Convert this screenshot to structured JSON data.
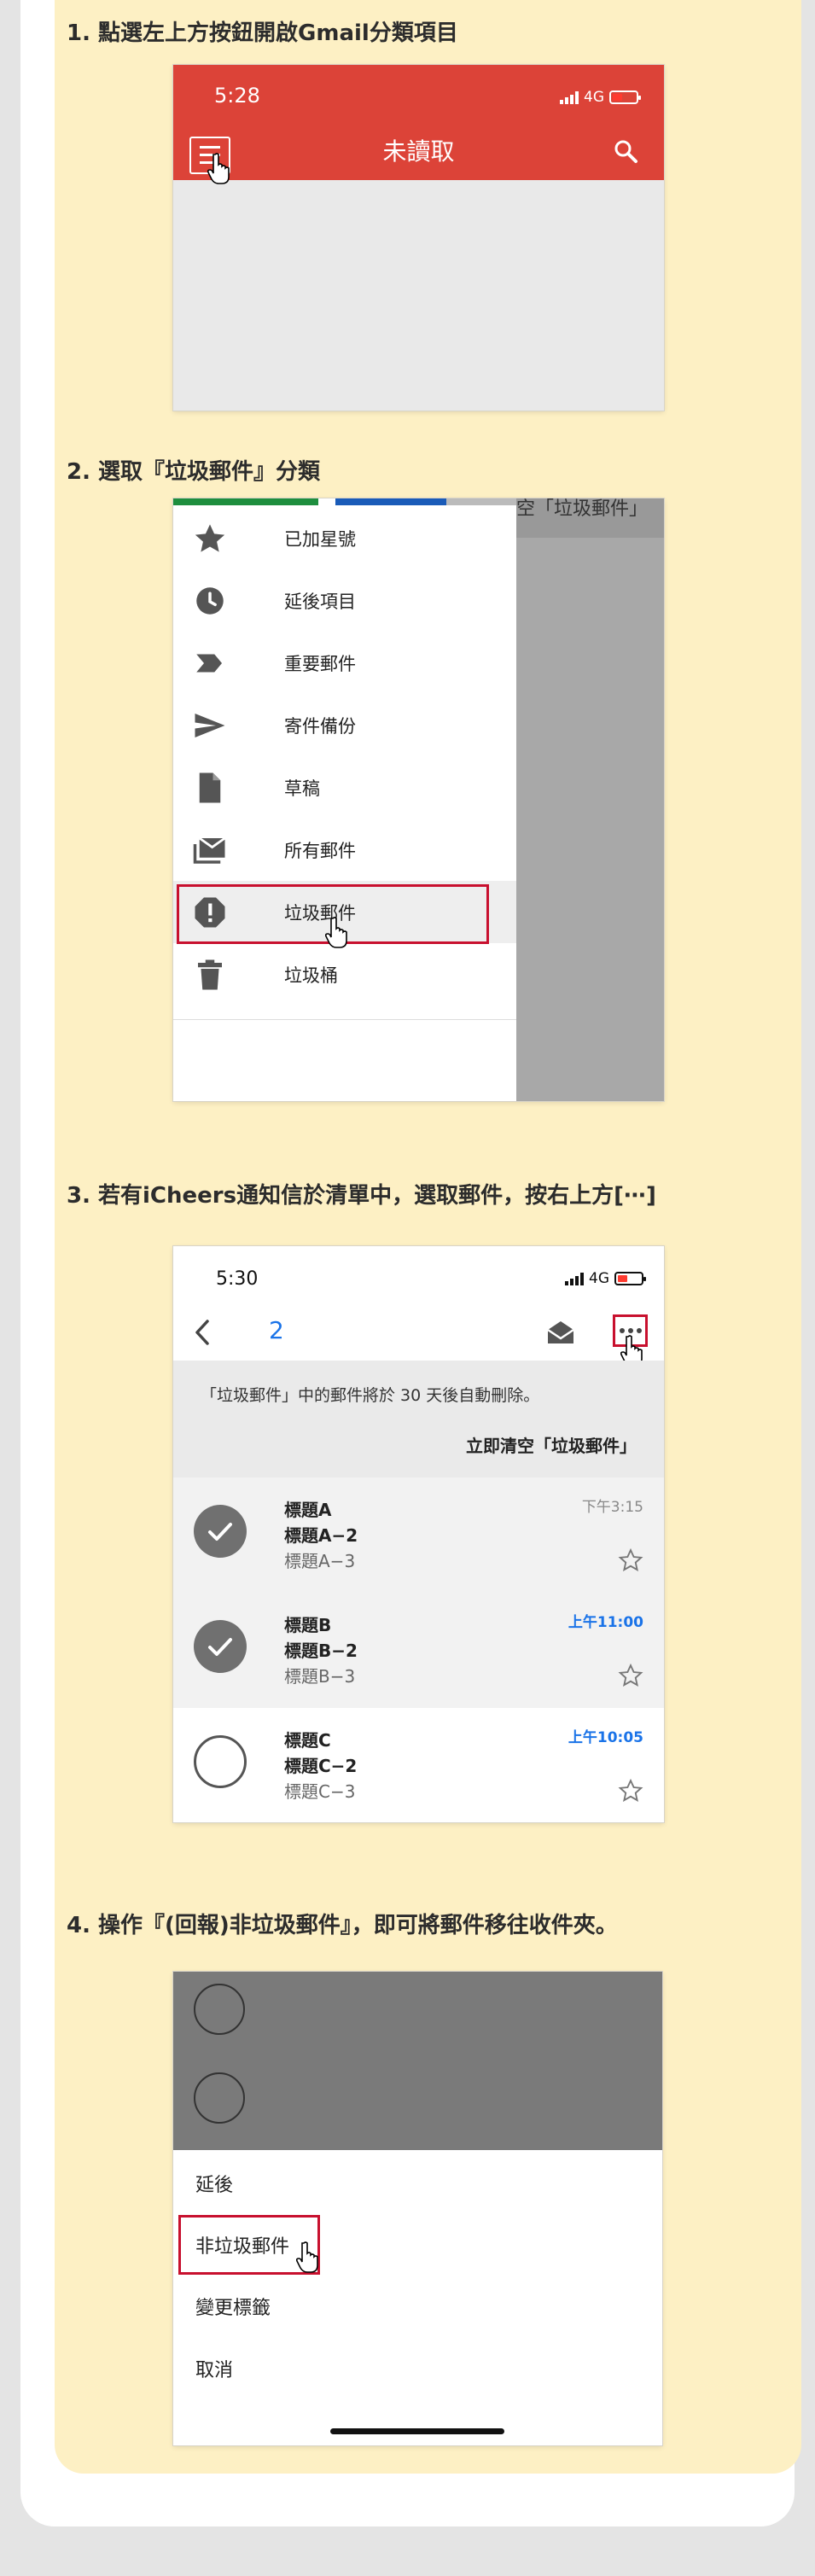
{
  "steps": [
    {
      "title": "1. 點選左上方按鈕開啟Gmail分類項目"
    },
    {
      "title": "2. 選取『垃圾郵件』分類"
    },
    {
      "title": "3. 若有iCheers通知信於清單中，選取郵件，按右上方[⋯]"
    },
    {
      "title": "4. 操作『(回報)非垃圾郵件』，即可將郵件移往收件夾。"
    }
  ],
  "screen1": {
    "time": "5:28",
    "network": "4G",
    "title": "未讀取",
    "accent": "#dc4338"
  },
  "screen2": {
    "overlay_text": "空「垃圾郵件」",
    "items": [
      {
        "label": "已加星號",
        "icon": "star-icon"
      },
      {
        "label": "延後項目",
        "icon": "clock-icon"
      },
      {
        "label": "重要郵件",
        "icon": "important-icon"
      },
      {
        "label": "寄件備份",
        "icon": "send-icon"
      },
      {
        "label": "草稿",
        "icon": "draft-icon"
      },
      {
        "label": "所有郵件",
        "icon": "all-mail-icon"
      },
      {
        "label": "垃圾郵件",
        "icon": "spam-icon",
        "selected": true
      },
      {
        "label": "垃圾桶",
        "icon": "trash-icon"
      }
    ]
  },
  "screen3": {
    "time": "5:30",
    "network": "4G",
    "selected_count": "2",
    "notice": "「垃圾郵件」中的郵件將於 30 天後自動刪除。",
    "empty_action": "立即清空「垃圾郵件」",
    "mails": [
      {
        "line1": "標題A",
        "line2": "標題A−2",
        "line3": "標題A−3",
        "time": "下午3:15",
        "selected": true,
        "unread_time": false
      },
      {
        "line1": "標題B",
        "line2": "標題B−2",
        "line3": "標題B−3",
        "time": "上午11:00",
        "selected": true,
        "unread_time": true
      },
      {
        "line1": "標題C",
        "line2": "標題C−2",
        "line3": "標題C−3",
        "time": "上午10:05",
        "selected": false,
        "unread_time": true
      }
    ]
  },
  "screen4": {
    "items": [
      "延後",
      "非垃圾郵件",
      "變更標籤",
      "取消"
    ]
  }
}
